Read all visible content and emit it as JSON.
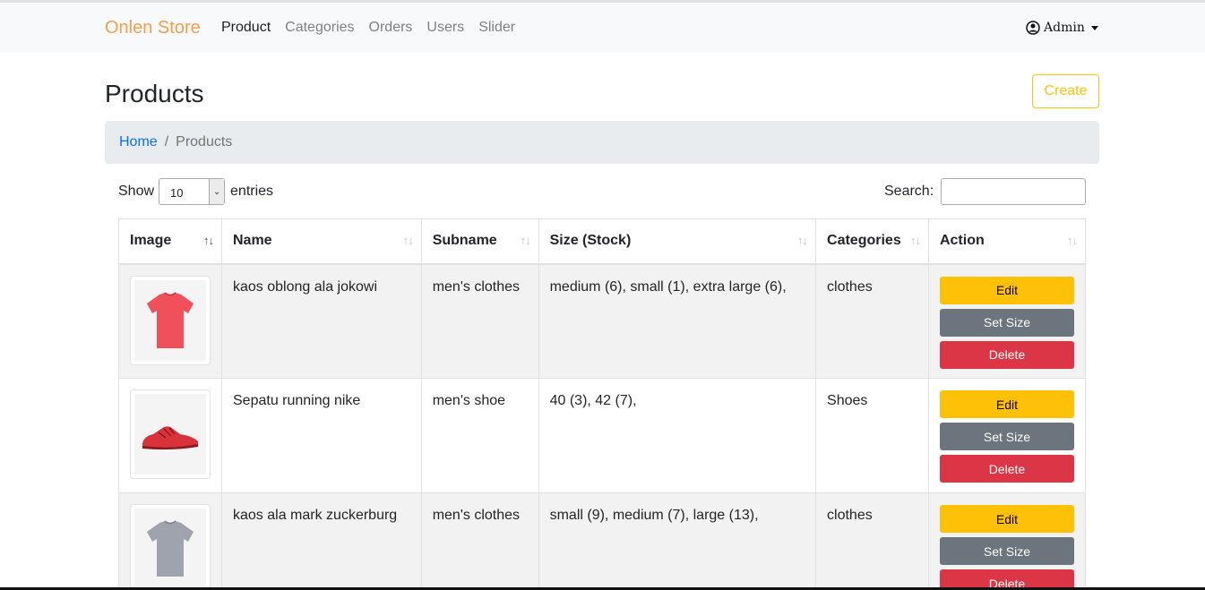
{
  "navbar": {
    "brand": "Onlen Store",
    "links": [
      {
        "label": "Product",
        "active": true
      },
      {
        "label": "Categories",
        "active": false
      },
      {
        "label": "Orders",
        "active": false
      },
      {
        "label": "Users",
        "active": false
      },
      {
        "label": "Slider",
        "active": false
      }
    ],
    "user": {
      "label": "Admin",
      "icon": "user-circle-icon"
    }
  },
  "page": {
    "title": "Products",
    "create_label": "Create"
  },
  "breadcrumb": {
    "home": "Home",
    "separator": "/",
    "current": "Products"
  },
  "table_controls": {
    "show_label": "Show",
    "entries_value": "10",
    "entries_label": "entries",
    "search_label": "Search:"
  },
  "table": {
    "columns": [
      "Image",
      "Name",
      "Subname",
      "Size (Stock)",
      "Categories",
      "Action"
    ],
    "rows": [
      {
        "image": "red-tshirt-image",
        "name": "kaos oblong ala jokowi",
        "subname": "men's clothes",
        "size_stock": "medium (6), small (1), extra large (6),",
        "category": "clothes"
      },
      {
        "image": "red-running-shoe-image",
        "name": "Sepatu running nike",
        "subname": "men's shoe",
        "size_stock": "40 (3), 42 (7),",
        "category": "Shoes"
      },
      {
        "image": "gray-tshirt-image",
        "name": "kaos ala mark zuckerburg",
        "subname": "men's clothes",
        "size_stock": "small (9), medium (7), large (13),",
        "category": "clothes"
      }
    ],
    "actions": {
      "edit": "Edit",
      "set_size": "Set Size",
      "delete": "Delete"
    }
  },
  "colors": {
    "brand": "#f0a04b",
    "warning": "#ffc107",
    "secondary": "#6c757d",
    "danger": "#dc3545",
    "link": "#0d6efd"
  }
}
